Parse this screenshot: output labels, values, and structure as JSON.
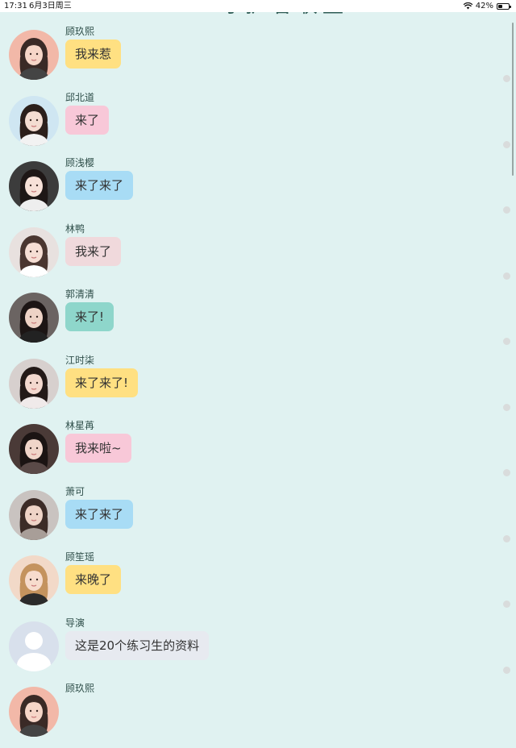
{
  "status_bar": {
    "time": "17:31",
    "date": "6月3日周三",
    "battery": "42%",
    "battery_level": 0.42
  },
  "header": {
    "title_clipped": "守护者联盟"
  },
  "messages": [
    {
      "name": "顾玖熙",
      "text": "我来惹",
      "bubble_color": "#ffe082",
      "avatar_bg": "#f2b8a8",
      "hair": "#3a2a26",
      "skin": "#f6d6c8",
      "shirt": "#444444"
    },
    {
      "name": "邱北道",
      "text": "来了",
      "bubble_color": "#f8c8d8",
      "avatar_bg": "#cfe6f2",
      "hair": "#2b1f1b",
      "skin": "#f4ddd2",
      "shirt": "#f2f2f2"
    },
    {
      "name": "顾浅樱",
      "text": "来了来了",
      "bubble_color": "#a8dcf5",
      "avatar_bg": "#3c3c3c",
      "hair": "#1e1716",
      "skin": "#f7e1d8",
      "shirt": "#eeeeee"
    },
    {
      "name": "林鸭",
      "text": "我来了",
      "bubble_color": "#f0d9dc",
      "avatar_bg": "#e8e1df",
      "hair": "#4a3630",
      "skin": "#f6ded4",
      "shirt": "#ffffff"
    },
    {
      "name": "郭清清",
      "text": "来了!",
      "bubble_color": "#8ed6cb",
      "avatar_bg": "#6b6462",
      "hair": "#1c1514",
      "skin": "#eed3c6",
      "shirt": "#222222"
    },
    {
      "name": "江时柒",
      "text": "来了来了!",
      "bubble_color": "#ffe082",
      "avatar_bg": "#d7d0ce",
      "hair": "#231a18",
      "skin": "#f3d9cf",
      "shirt": "#f0eaea"
    },
    {
      "name": "林星苒",
      "text": "我来啦~",
      "bubble_color": "#f8c8d8",
      "avatar_bg": "#4a3a37",
      "hair": "#1b1413",
      "skin": "#f0d5c9",
      "shirt": "#5a4a48"
    },
    {
      "name": "萧可",
      "text": "来了来了",
      "bubble_color": "#a8dcf5",
      "avatar_bg": "#c9c3c0",
      "hair": "#3c2c27",
      "skin": "#efd4c7",
      "shirt": "#a89e98"
    },
    {
      "name": "顾笙瑶",
      "text": "来晚了",
      "bubble_color": "#ffe082",
      "avatar_bg": "#f2d9c8",
      "hair": "#c4935e",
      "skin": "#f7dccd",
      "shirt": "#2b2b2b"
    },
    {
      "name": "导演",
      "text": "这是20个练习生的资料",
      "bubble_color": "#e7eaf0",
      "avatar_bg": "#d8e0ec",
      "hair": "#ffffff",
      "skin": "#ffffff",
      "shirt": "#ffffff",
      "placeholder": true
    },
    {
      "name": "顾玖熙",
      "text": "",
      "bubble_color": "#ffe082",
      "avatar_bg": "#f2b8a8",
      "hair": "#3a2a26",
      "skin": "#f6d6c8",
      "shirt": "#444444"
    }
  ]
}
